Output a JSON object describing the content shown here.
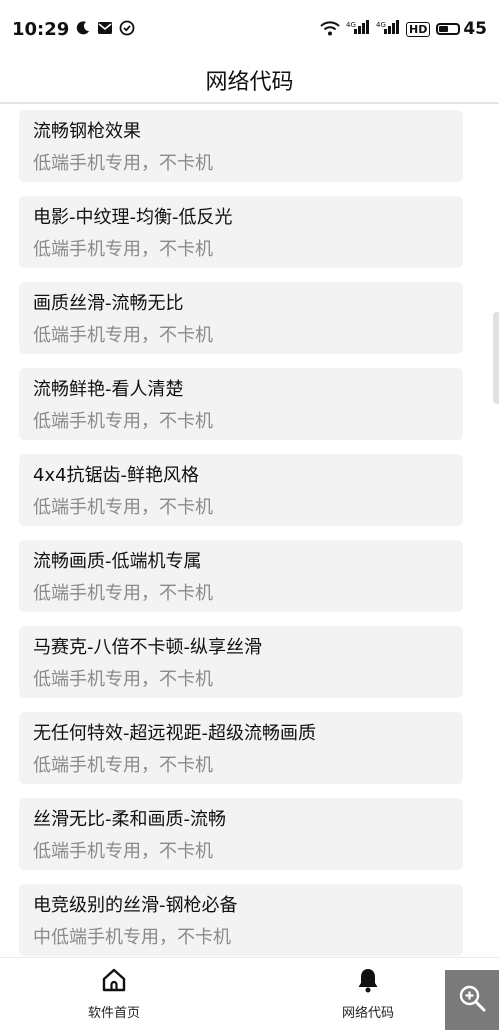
{
  "status_bar": {
    "time": "10:29",
    "left_icons": [
      "moon-icon",
      "mail-icon",
      "check-circle-icon"
    ],
    "right_icons": [
      "wifi-icon",
      "signal-icon",
      "signal-icon",
      "hd-icon",
      "battery-icon"
    ],
    "hd_label": "HD",
    "battery_level": "45",
    "battery_fraction": 0.45
  },
  "header": {
    "title": "网络代码"
  },
  "items": [
    {
      "title": "流畅钢枪效果",
      "subtitle": "低端手机专用，不卡机"
    },
    {
      "title": "电影-中纹理-均衡-低反光",
      "subtitle": "低端手机专用，不卡机"
    },
    {
      "title": "画质丝滑-流畅无比",
      "subtitle": "低端手机专用，不卡机"
    },
    {
      "title": "流畅鲜艳-看人清楚",
      "subtitle": "低端手机专用，不卡机"
    },
    {
      "title": "4x4抗锯齿-鲜艳风格",
      "subtitle": "低端手机专用，不卡机"
    },
    {
      "title": "流畅画质-低端机专属",
      "subtitle": "低端手机专用，不卡机"
    },
    {
      "title": "马赛克-八倍不卡顿-纵享丝滑",
      "subtitle": "低端手机专用，不卡机"
    },
    {
      "title": "无任何特效-超远视距-超级流畅画质",
      "subtitle": "低端手机专用，不卡机"
    },
    {
      "title": "丝滑无比-柔和画质-流畅",
      "subtitle": "低端手机专用，不卡机"
    },
    {
      "title": "电竞级别的丝滑-钢枪必备",
      "subtitle": "中低端手机专用，不卡机"
    }
  ],
  "tabs": [
    {
      "label": "软件首页",
      "icon": "home-icon"
    },
    {
      "label": "网络代码",
      "icon": "bell-icon"
    }
  ],
  "zoom_button": {
    "icon": "zoom-in-icon"
  }
}
